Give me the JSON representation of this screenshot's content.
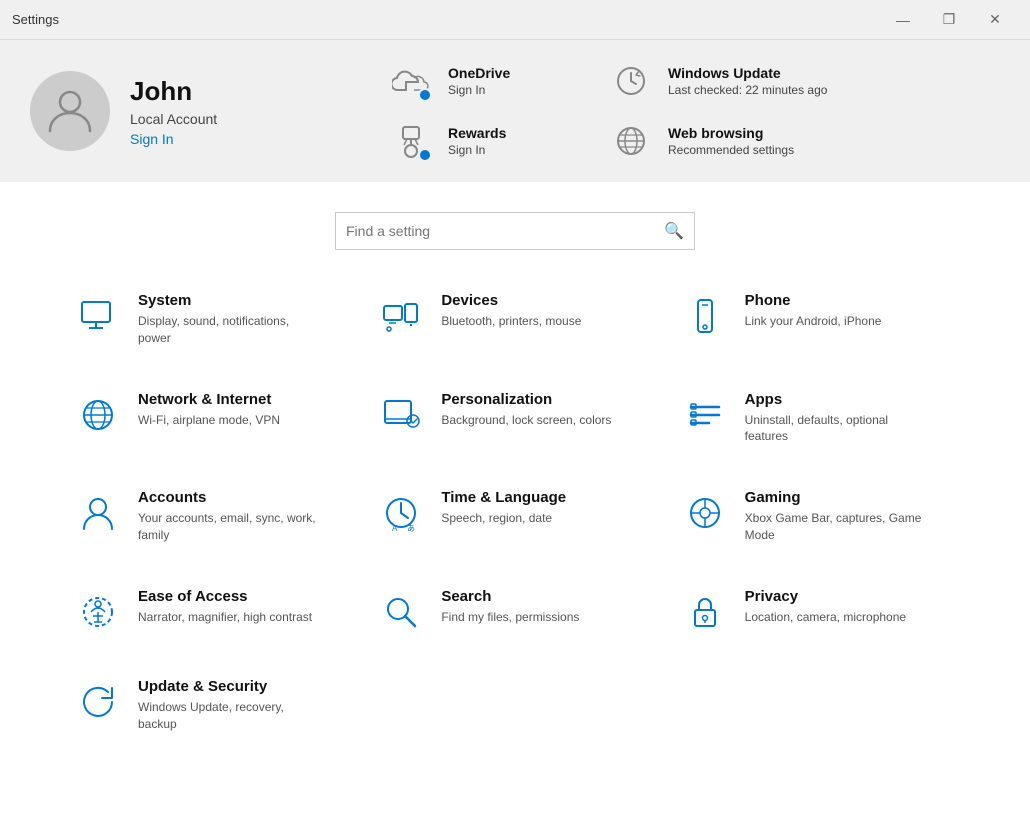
{
  "titlebar": {
    "title": "Settings",
    "minimize": "—",
    "maximize": "❐",
    "close": "✕"
  },
  "profile": {
    "name": "John",
    "account_type": "Local Account",
    "signin_label": "Sign In"
  },
  "services": [
    {
      "id": "onedrive",
      "title": "OneDrive",
      "subtitle": "Sign In",
      "has_badge": true
    },
    {
      "id": "rewards",
      "title": "Rewards",
      "subtitle": "Sign In",
      "has_badge": true
    },
    {
      "id": "windows-update",
      "title": "Windows Update",
      "subtitle": "Last checked: 22 minutes ago",
      "has_badge": false
    },
    {
      "id": "web-browsing",
      "title": "Web browsing",
      "subtitle": "Recommended settings",
      "has_badge": false
    }
  ],
  "search": {
    "placeholder": "Find a setting"
  },
  "settings_items": [
    {
      "id": "system",
      "title": "System",
      "desc": "Display, sound, notifications, power"
    },
    {
      "id": "devices",
      "title": "Devices",
      "desc": "Bluetooth, printers, mouse"
    },
    {
      "id": "phone",
      "title": "Phone",
      "desc": "Link your Android, iPhone"
    },
    {
      "id": "network",
      "title": "Network & Internet",
      "desc": "Wi-Fi, airplane mode, VPN"
    },
    {
      "id": "personalization",
      "title": "Personalization",
      "desc": "Background, lock screen, colors"
    },
    {
      "id": "apps",
      "title": "Apps",
      "desc": "Uninstall, defaults, optional features"
    },
    {
      "id": "accounts",
      "title": "Accounts",
      "desc": "Your accounts, email, sync, work, family"
    },
    {
      "id": "time",
      "title": "Time & Language",
      "desc": "Speech, region, date"
    },
    {
      "id": "gaming",
      "title": "Gaming",
      "desc": "Xbox Game Bar, captures, Game Mode"
    },
    {
      "id": "ease",
      "title": "Ease of Access",
      "desc": "Narrator, magnifier, high contrast"
    },
    {
      "id": "search",
      "title": "Search",
      "desc": "Find my files, permissions"
    },
    {
      "id": "privacy",
      "title": "Privacy",
      "desc": "Location, camera, microphone"
    },
    {
      "id": "update",
      "title": "Update & Security",
      "desc": "Windows Update, recovery, backup"
    }
  ]
}
